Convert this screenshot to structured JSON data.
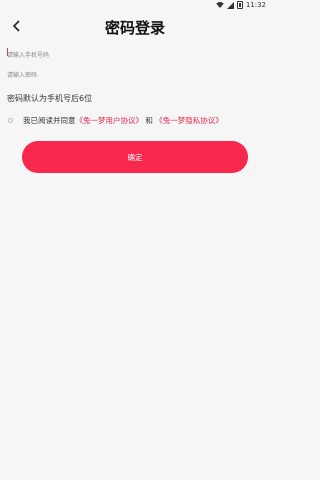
{
  "status_bar": {
    "time": "11:32"
  },
  "header": {
    "title": "密码登录",
    "back_icon": "chevron-left-icon"
  },
  "form": {
    "phone_placeholder": "请输入手机号码",
    "phone_value": "",
    "password_placeholder": "请输入密码",
    "password_value": ""
  },
  "hint": "密码默认为手机号后6位",
  "agreement": {
    "prefix": "我已阅读并同意",
    "user_agreement": "《兔一梦用户协议》",
    "and": "和",
    "privacy_policy": "《兔一梦隐私协议》",
    "checked": false
  },
  "confirm_label": "确定",
  "colors": {
    "accent": "#f8274d",
    "background": "#f6f6f6",
    "link": "#e8284d"
  }
}
